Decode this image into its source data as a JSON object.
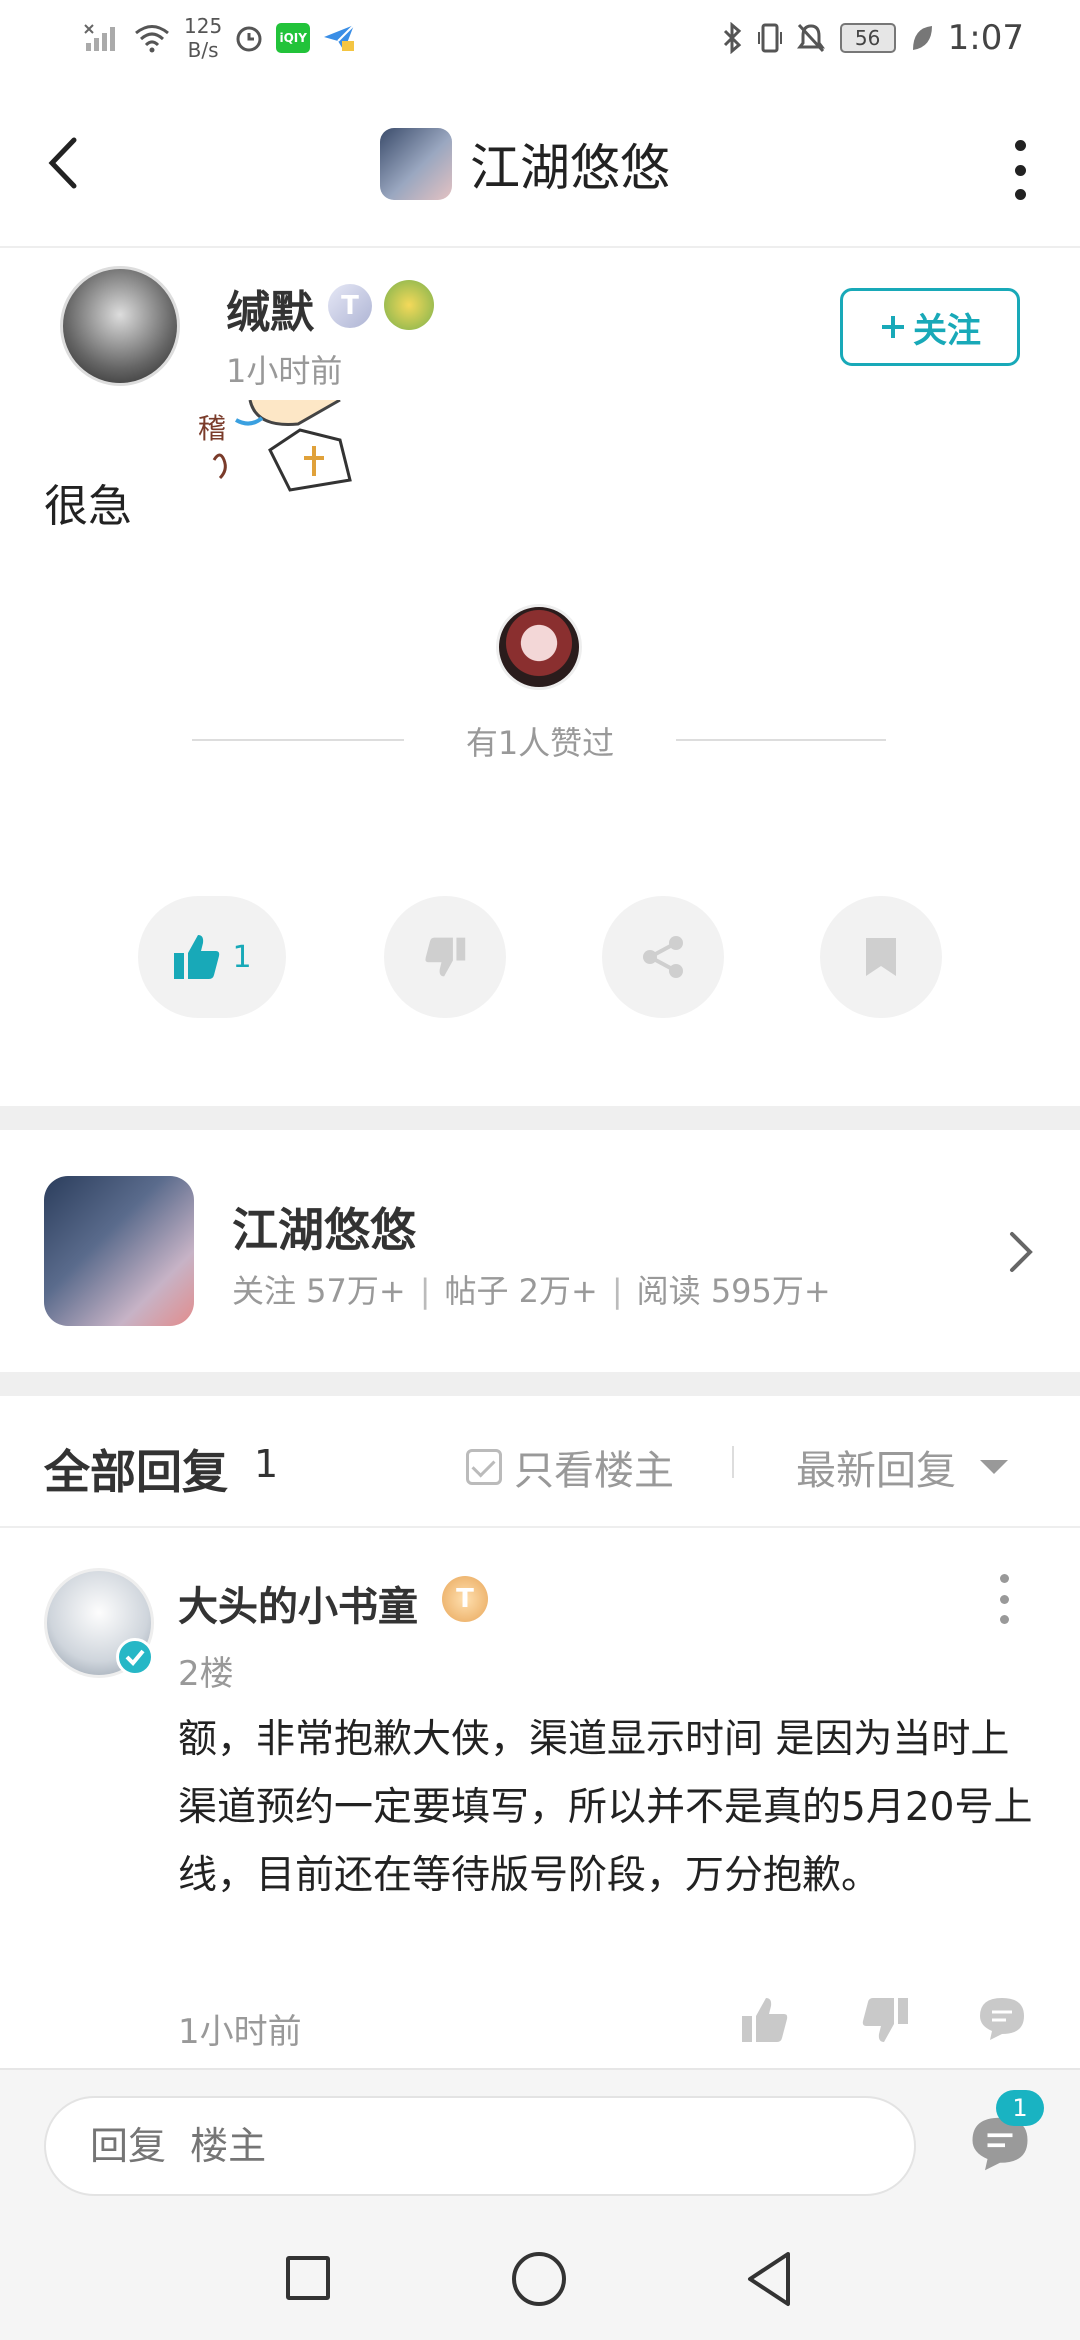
{
  "status_bar": {
    "net_speed": "125",
    "net_unit": "B/s",
    "battery": "56",
    "time": "1:07",
    "app_badge": "iQIY"
  },
  "nav": {
    "title": "江湖悠悠"
  },
  "post": {
    "author": "缄默",
    "level": "T",
    "time": "1小时前",
    "follow_label": "关注",
    "text": "很急",
    "liked_by_text": "有1人赞过",
    "like_count": "1"
  },
  "game_card": {
    "name": "江湖悠悠",
    "followers": "关注 57万+",
    "posts": "帖子 2万+",
    "reads": "阅读 595万+"
  },
  "replies_section": {
    "title": "全部回复",
    "count": "1",
    "only_op_label": "只看楼主",
    "sort_label": "最新回复"
  },
  "reply": {
    "author": "大头的小书童",
    "level": "T",
    "floor": "2楼",
    "text": "额，非常抱歉大侠，渠道显示时间 是因为当时上渠道预约一定要填写，所以并不是真的5月20号上线，目前还在等待版号阶段，万分抱歉。",
    "time": "1小时前"
  },
  "bottom_bar": {
    "input_placeholder": "回复  楼主",
    "comments_badge": "1"
  },
  "colors": {
    "accent": "#18a9b8",
    "divider": "#efefef"
  }
}
